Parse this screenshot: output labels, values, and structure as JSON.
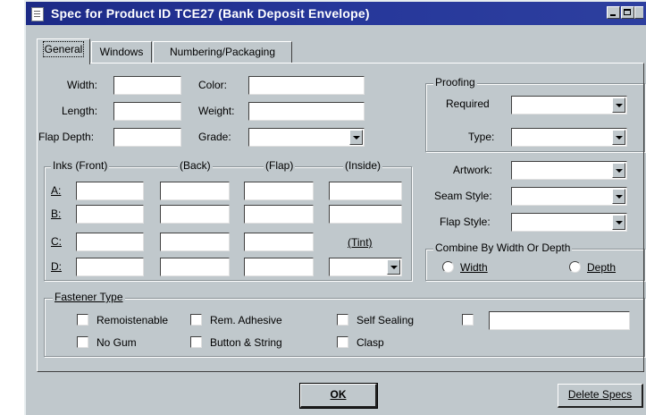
{
  "window": {
    "title": "Spec for Product ID TCE27 (Bank Deposit Envelope)"
  },
  "tabs": [
    {
      "label": "General"
    },
    {
      "label": "Windows"
    },
    {
      "label": "Numbering/Packaging"
    }
  ],
  "dimensions": {
    "width_label": "Width:",
    "length_label": "Length:",
    "flap_depth_label": "Flap Depth:",
    "color_label": "Color:",
    "weight_label": "Weight:",
    "grade_label": "Grade:"
  },
  "proofing": {
    "title": "Proofing",
    "required_label": "Required",
    "type_label": "Type:"
  },
  "inks": {
    "col_front": "Inks (Front)",
    "col_back": "(Back)",
    "col_flap": "(Flap)",
    "col_inside": "(Inside)",
    "row_a": "A:",
    "row_b": "B:",
    "row_c": "C:",
    "row_d": "D:",
    "tint_label": "(Tint)"
  },
  "styles": {
    "artwork_label": "Artwork:",
    "seam_style_label": "Seam Style:",
    "flap_style_label": "Flap Style:"
  },
  "combine": {
    "title": "Combine By Width Or Depth",
    "width_label": "Width",
    "depth_label": "Depth"
  },
  "fastener": {
    "title": "Fastener Type",
    "remoistenable": "Remoistenable",
    "rem_adhesive": "Rem. Adhesive",
    "self_sealing": "Self Sealing",
    "no_gum": "No Gum",
    "button_string": "Button & String",
    "clasp": "Clasp"
  },
  "buttons": {
    "ok": "OK",
    "delete_specs": "Delete Specs"
  }
}
